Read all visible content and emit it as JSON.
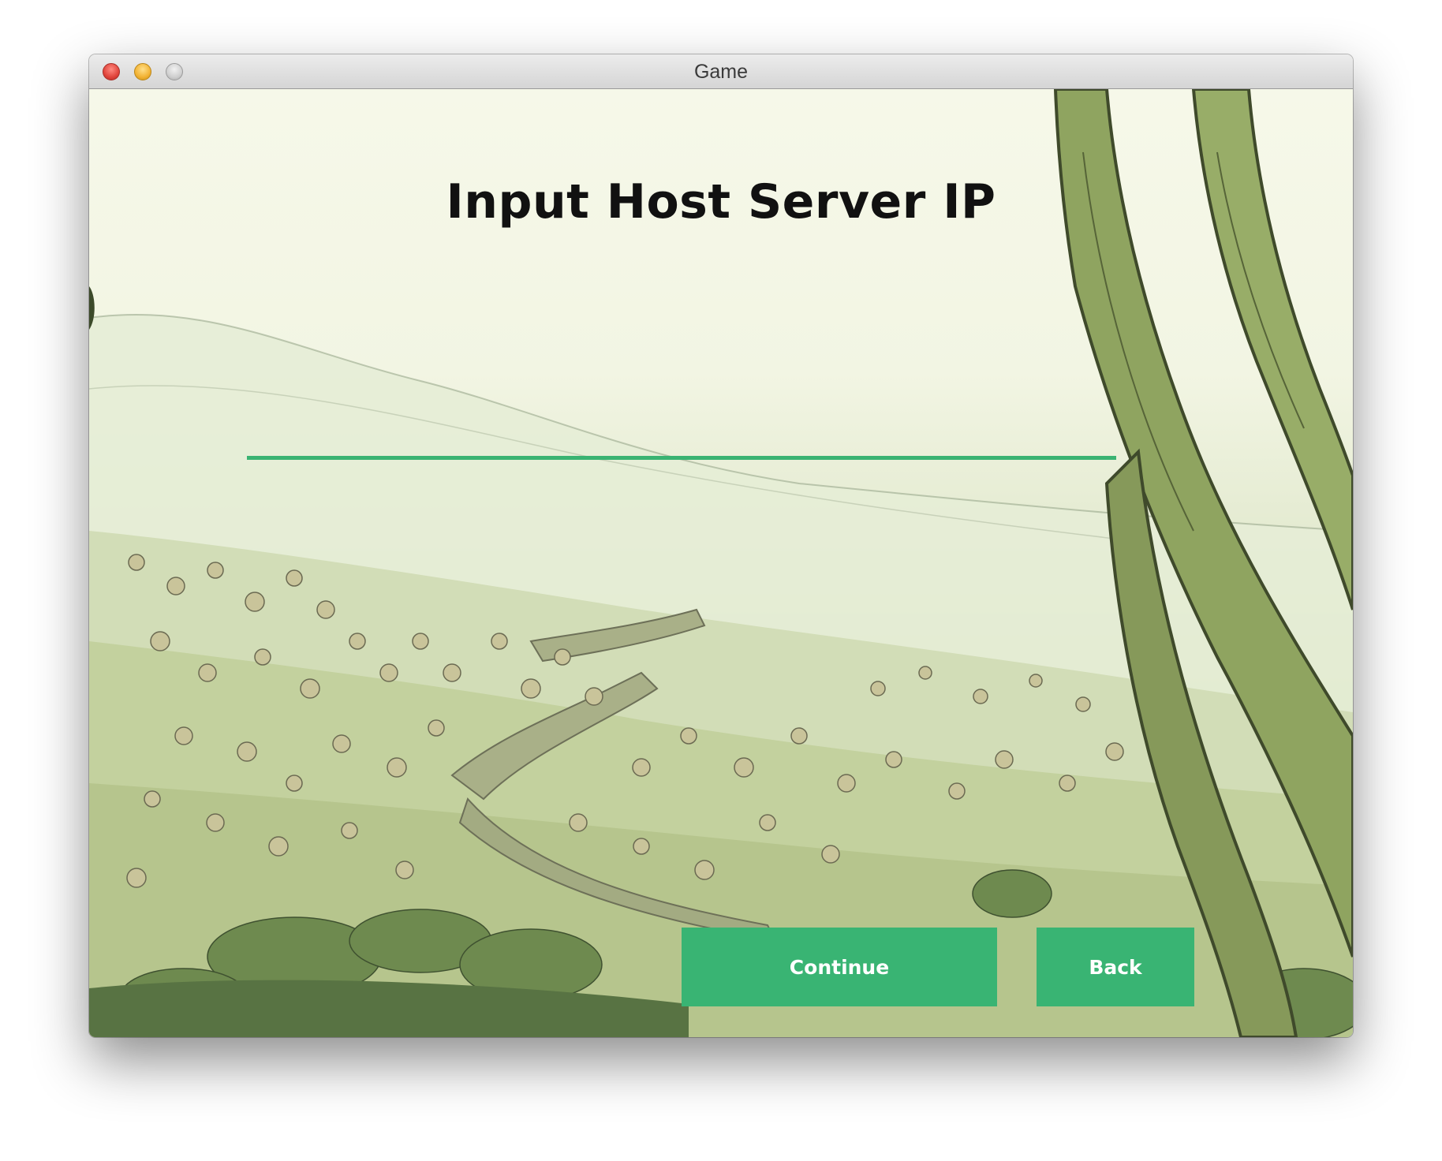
{
  "window": {
    "title": "Game",
    "controls": [
      "close",
      "minimize",
      "zoom"
    ]
  },
  "screen": {
    "heading": "Input Host Server IP",
    "ip_input": {
      "value": "",
      "placeholder": ""
    },
    "buttons": {
      "continue_label": "Continue",
      "back_label": "Back"
    }
  },
  "colors": {
    "accent": "#39b473",
    "heading": "#111111"
  }
}
